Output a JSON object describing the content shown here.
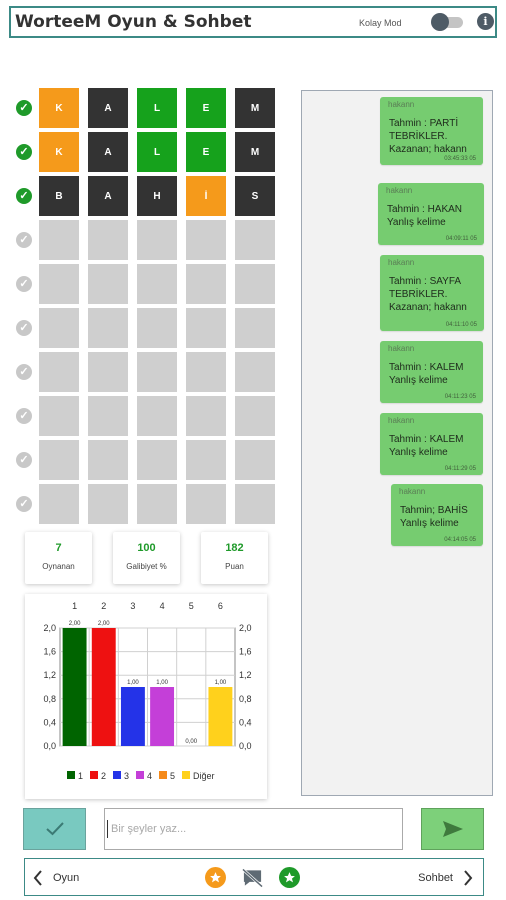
{
  "header": {
    "title": "WorteeM Oyun & Sohbet",
    "mode_label": "Kolay Mod",
    "mode_on": false,
    "info_icon": "info-icon"
  },
  "board": {
    "rows": [
      {
        "status": "ok",
        "tiles": [
          {
            "letter": "K",
            "color": "orange"
          },
          {
            "letter": "A",
            "color": "dark"
          },
          {
            "letter": "L",
            "color": "green"
          },
          {
            "letter": "E",
            "color": "green"
          },
          {
            "letter": "M",
            "color": "dark"
          }
        ]
      },
      {
        "status": "ok",
        "tiles": [
          {
            "letter": "K",
            "color": "orange"
          },
          {
            "letter": "A",
            "color": "dark"
          },
          {
            "letter": "L",
            "color": "green"
          },
          {
            "letter": "E",
            "color": "green"
          },
          {
            "letter": "M",
            "color": "dark"
          }
        ]
      },
      {
        "status": "ok",
        "tiles": [
          {
            "letter": "B",
            "color": "dark"
          },
          {
            "letter": "A",
            "color": "dark"
          },
          {
            "letter": "H",
            "color": "dark"
          },
          {
            "letter": "İ",
            "color": "orange"
          },
          {
            "letter": "S",
            "color": "dark"
          }
        ]
      },
      {
        "status": "empty",
        "tiles": [
          {
            "letter": "",
            "color": "gray"
          },
          {
            "letter": "",
            "color": "gray"
          },
          {
            "letter": "",
            "color": "gray"
          },
          {
            "letter": "",
            "color": "gray"
          },
          {
            "letter": "",
            "color": "gray"
          }
        ]
      },
      {
        "status": "empty",
        "tiles": [
          {
            "letter": "",
            "color": "gray"
          },
          {
            "letter": "",
            "color": "gray"
          },
          {
            "letter": "",
            "color": "gray"
          },
          {
            "letter": "",
            "color": "gray"
          },
          {
            "letter": "",
            "color": "gray"
          }
        ]
      },
      {
        "status": "empty",
        "tiles": [
          {
            "letter": "",
            "color": "gray"
          },
          {
            "letter": "",
            "color": "gray"
          },
          {
            "letter": "",
            "color": "gray"
          },
          {
            "letter": "",
            "color": "gray"
          },
          {
            "letter": "",
            "color": "gray"
          }
        ]
      },
      {
        "status": "empty",
        "tiles": [
          {
            "letter": "",
            "color": "gray"
          },
          {
            "letter": "",
            "color": "gray"
          },
          {
            "letter": "",
            "color": "gray"
          },
          {
            "letter": "",
            "color": "gray"
          },
          {
            "letter": "",
            "color": "gray"
          }
        ]
      },
      {
        "status": "empty",
        "tiles": [
          {
            "letter": "",
            "color": "gray"
          },
          {
            "letter": "",
            "color": "gray"
          },
          {
            "letter": "",
            "color": "gray"
          },
          {
            "letter": "",
            "color": "gray"
          },
          {
            "letter": "",
            "color": "gray"
          }
        ]
      },
      {
        "status": "empty",
        "tiles": [
          {
            "letter": "",
            "color": "gray"
          },
          {
            "letter": "",
            "color": "gray"
          },
          {
            "letter": "",
            "color": "gray"
          },
          {
            "letter": "",
            "color": "gray"
          },
          {
            "letter": "",
            "color": "gray"
          }
        ]
      },
      {
        "status": "empty",
        "tiles": [
          {
            "letter": "",
            "color": "gray"
          },
          {
            "letter": "",
            "color": "gray"
          },
          {
            "letter": "",
            "color": "gray"
          },
          {
            "letter": "",
            "color": "gray"
          },
          {
            "letter": "",
            "color": "gray"
          }
        ]
      }
    ]
  },
  "stats": [
    {
      "value": "7",
      "label": "Oynanan"
    },
    {
      "value": "100",
      "label": "Galibiyet %"
    },
    {
      "value": "182",
      "label": "Puan"
    }
  ],
  "chart_data": {
    "type": "bar",
    "categories": [
      "1",
      "2",
      "3",
      "4",
      "5",
      "6"
    ],
    "values": [
      2.0,
      2.0,
      1.0,
      1.0,
      0.0,
      1.0
    ],
    "value_labels": [
      "2,00",
      "2,00",
      "1,00",
      "1,00",
      "0,00",
      "1,00"
    ],
    "colors": [
      "#006400",
      "#ee1111",
      "#2433e8",
      "#c43fd8",
      "#f58a1a",
      "#ffd11c"
    ],
    "yticks": [
      "0,0",
      "0,4",
      "0,8",
      "1,2",
      "1,6",
      "2,0"
    ],
    "ylim": [
      0,
      2.0
    ],
    "grid": true,
    "legend_position": "bottom",
    "legend": [
      "1",
      "2",
      "3",
      "4",
      "5",
      "Diğer"
    ]
  },
  "chat": {
    "messages": [
      {
        "user": "hakann",
        "lines": [
          "Tahmin : PARTİ",
          "TEBRİKLER.",
          "Kazanan; hakann"
        ],
        "time": "03:45:33 05"
      },
      {
        "user": "hakann",
        "lines": [
          "Tahmin : HAKAN",
          "Yanlış kelime"
        ],
        "time": "04:09:11 05"
      },
      {
        "user": "hakann",
        "lines": [
          "Tahmin : SAYFA",
          "TEBRİKLER.",
          "Kazanan; hakann"
        ],
        "time": "04:11:10 05"
      },
      {
        "user": "hakann",
        "lines": [
          "Tahmin : KALEM",
          "Yanlış kelime"
        ],
        "time": "04:11:23 05"
      },
      {
        "user": "hakann",
        "lines": [
          "Tahmin : KALEM",
          "Yanlış kelime"
        ],
        "time": "04:11:29 05"
      },
      {
        "user": "hakann",
        "lines": [
          "Tahmin; BAHİS",
          "Yanlış kelime"
        ],
        "time": "04:14:05 05"
      }
    ]
  },
  "composer": {
    "placeholder": "Bir şeyler yaz...",
    "check_icon": "check-icon",
    "send_icon": "send-icon"
  },
  "nav": {
    "left_label": "Oyun",
    "right_label": "Sohbet",
    "icons": [
      "star-orange-icon",
      "no-chat-icon",
      "star-green-icon"
    ]
  }
}
